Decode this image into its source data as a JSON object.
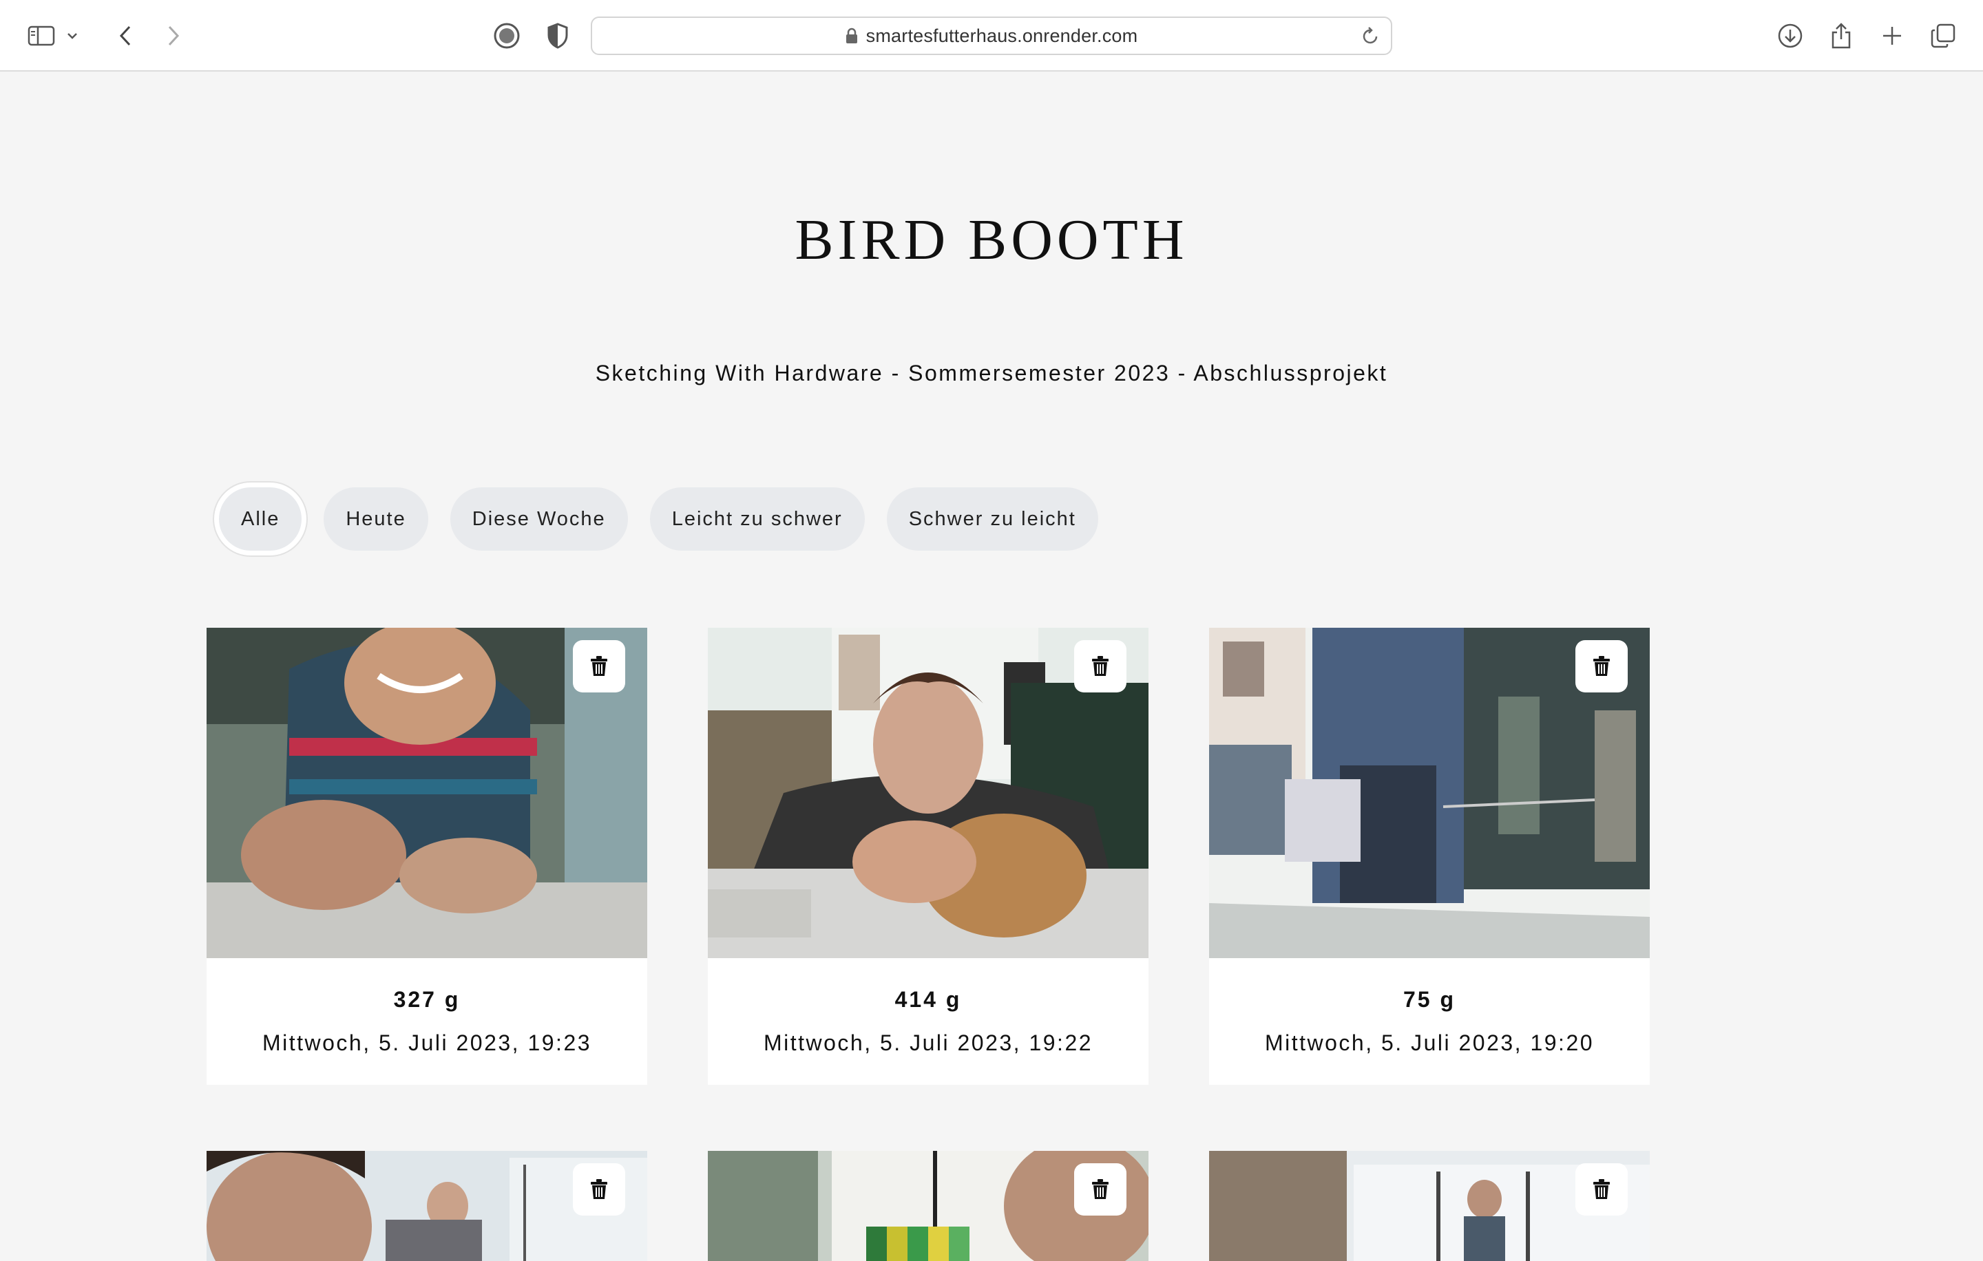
{
  "browser": {
    "url": "smartesfutterhaus.onrender.com",
    "icons": [
      "sidebar-icon",
      "chevron-down-icon",
      "back-icon",
      "forward-icon",
      "privacy-report-icon",
      "shield-icon",
      "lock-icon",
      "reload-icon",
      "download-icon",
      "share-icon",
      "new-tab-icon",
      "tab-overview-icon"
    ]
  },
  "page": {
    "title": "BIRD BOOTH",
    "subtitle": "Sketching With Hardware - Sommersemester 2023 - Abschlussprojekt"
  },
  "filters": [
    {
      "label": "Alle",
      "active": true
    },
    {
      "label": "Heute",
      "active": false
    },
    {
      "label": "Diese Woche",
      "active": false
    },
    {
      "label": "Leicht zu schwer",
      "active": false
    },
    {
      "label": "Schwer zu leicht",
      "active": false
    }
  ],
  "entries": [
    {
      "weight": "327 g",
      "date": "Mittwoch, 5. Juli 2023, 19:23",
      "icon": "trash-icon"
    },
    {
      "weight": "414 g",
      "date": "Mittwoch, 5. Juli 2023, 19:22",
      "icon": "trash-icon"
    },
    {
      "weight": "75 g",
      "date": "Mittwoch, 5. Juli 2023, 19:20",
      "icon": "trash-icon"
    }
  ],
  "colors": {
    "page_bg": "#f5f5f5",
    "pill_bg": "#e8eaed",
    "card_bg": "#ffffff"
  }
}
